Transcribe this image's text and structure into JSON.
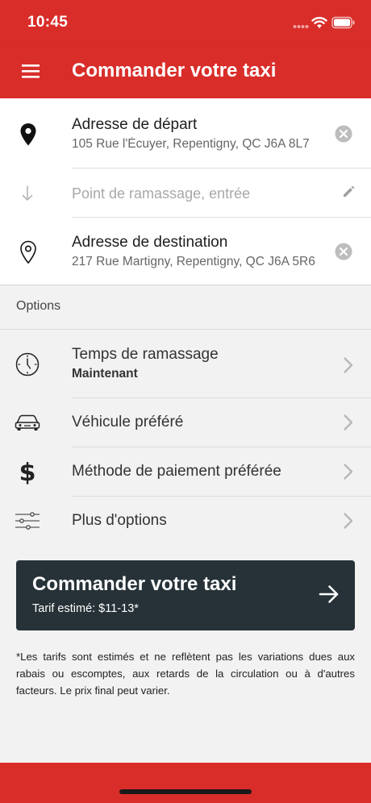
{
  "status_bar": {
    "time": "10:45"
  },
  "app_bar": {
    "title": "Commander votre taxi"
  },
  "departure": {
    "label": "Adresse de départ",
    "address": "105 Rue l'Écuyer, Repentigny, QC J6A 8L7"
  },
  "pickup": {
    "placeholder": "Point de ramassage, entrée",
    "value": ""
  },
  "destination": {
    "label": "Adresse de destination",
    "address": "217 Rue Martigny, Repentigny, QC J6A 5R6"
  },
  "options": {
    "header": "Options",
    "items": [
      {
        "icon": "clock-icon",
        "label": "Temps de ramassage",
        "value": "Maintenant"
      },
      {
        "icon": "car-icon",
        "label": "Véhicule préféré"
      },
      {
        "icon": "dollar-icon",
        "label": "Méthode de paiement préférée"
      },
      {
        "icon": "sliders-icon",
        "label": "Plus d'options"
      }
    ]
  },
  "order_button": {
    "label": "Commander votre taxi",
    "fare": "Tarif estimé: $11-13*"
  },
  "disclaimer": "*Les tarifs sont estimés et ne reflètent pas les variations dues aux rabais ou escomptes, aux retards de la circulation ou à d'autres facteurs. Le prix final peut varier.",
  "colors": {
    "brand_red": "#d92d2a",
    "button_dark": "#263238",
    "background": "#f2f2f2"
  }
}
